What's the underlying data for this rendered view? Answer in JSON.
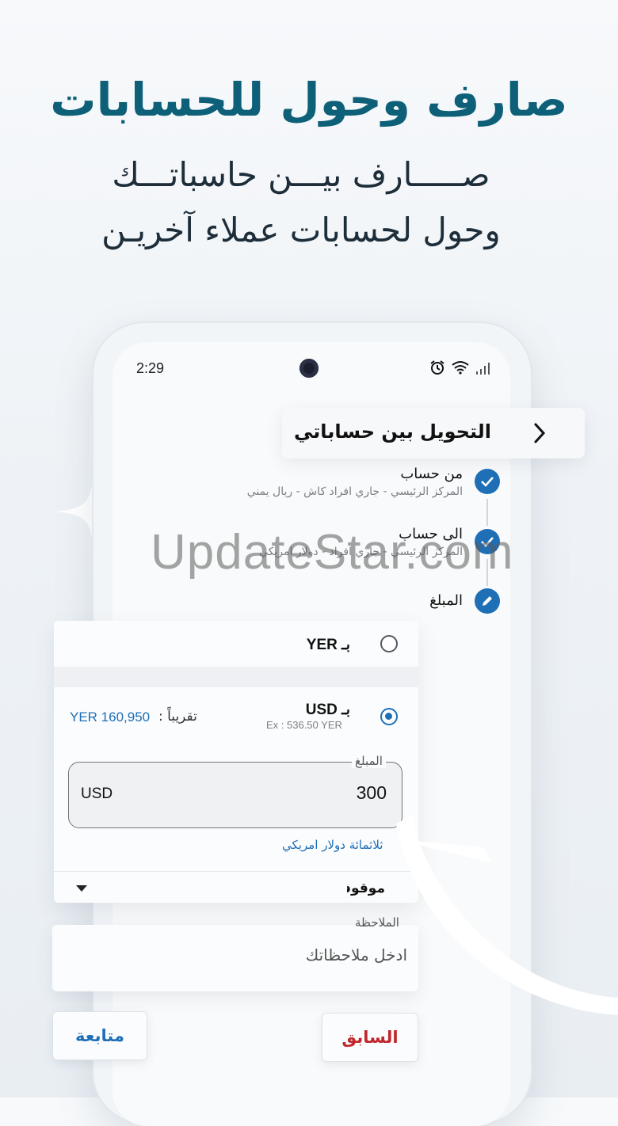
{
  "promo": {
    "headline": "صارف وحول للحسابات",
    "line1": "صـــــارف بيـــن حاسباتـــك",
    "line2": "وحول لحسابات عملاء آخريـن"
  },
  "status_bar": {
    "time": "2:29"
  },
  "screen": {
    "title": "التحويل بين حساباتي"
  },
  "steps": [
    {
      "label": "من حساب",
      "detail": "المركز الرئيسي - جاري افراد كاش - ريال يمني"
    },
    {
      "label": "الى حساب",
      "detail": "المركز الرئيسي - جاري افراد - دولار امريكي"
    },
    {
      "label": "المبلغ"
    }
  ],
  "currency_options": [
    {
      "label": "بـ YER",
      "selected": false
    },
    {
      "label": "بـ USD",
      "selected": true,
      "rate": "Ex : 536.50 YER",
      "approx_label": "تقريباً :",
      "approx_value": "YER 160,950"
    }
  ],
  "amount": {
    "legend": "المبلغ",
    "currency": "USD",
    "value": "300",
    "words": "ثلاثمائة دولار امريكي"
  },
  "dropdown": {
    "value": "موقوف"
  },
  "note": {
    "legend": "الملاحظة",
    "placeholder": "ادخل ملاحظاتك"
  },
  "buttons": {
    "next": "متابعة",
    "prev": "السابق"
  },
  "watermark": "UpdateStar.com",
  "colors": {
    "accent": "#1f6fb6",
    "headline": "#0d6078",
    "danger": "#c0282d"
  }
}
